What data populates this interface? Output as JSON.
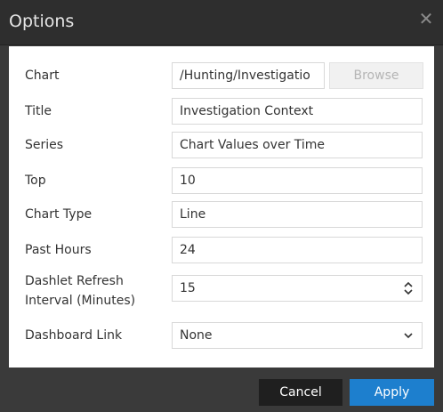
{
  "dialog": {
    "title": "Options",
    "close_icon": "close-icon"
  },
  "form": {
    "chart": {
      "label": "Chart",
      "value": "/Hunting/Investigatio",
      "browse_label": "Browse"
    },
    "title": {
      "label": "Title",
      "value": "Investigation Context"
    },
    "series": {
      "label": "Series",
      "value": "Chart Values over Time"
    },
    "top": {
      "label": "Top",
      "value": "10"
    },
    "chart_type": {
      "label": "Chart Type",
      "value": "Line"
    },
    "past_hours": {
      "label": "Past Hours",
      "value": "24"
    },
    "refresh": {
      "label_line1": "Dashlet Refresh",
      "label_line2": "Interval (Minutes)",
      "value": "15",
      "icon": "spinner-arrows-icon"
    },
    "dashboard_link": {
      "label": "Dashboard Link",
      "value": "None",
      "icon": "chevron-down-icon"
    }
  },
  "footer": {
    "cancel_label": "Cancel",
    "apply_label": "Apply"
  },
  "colors": {
    "accent": "#1d7fce",
    "titlebar": "#2e2e2e",
    "background": "#3a3a3a"
  }
}
